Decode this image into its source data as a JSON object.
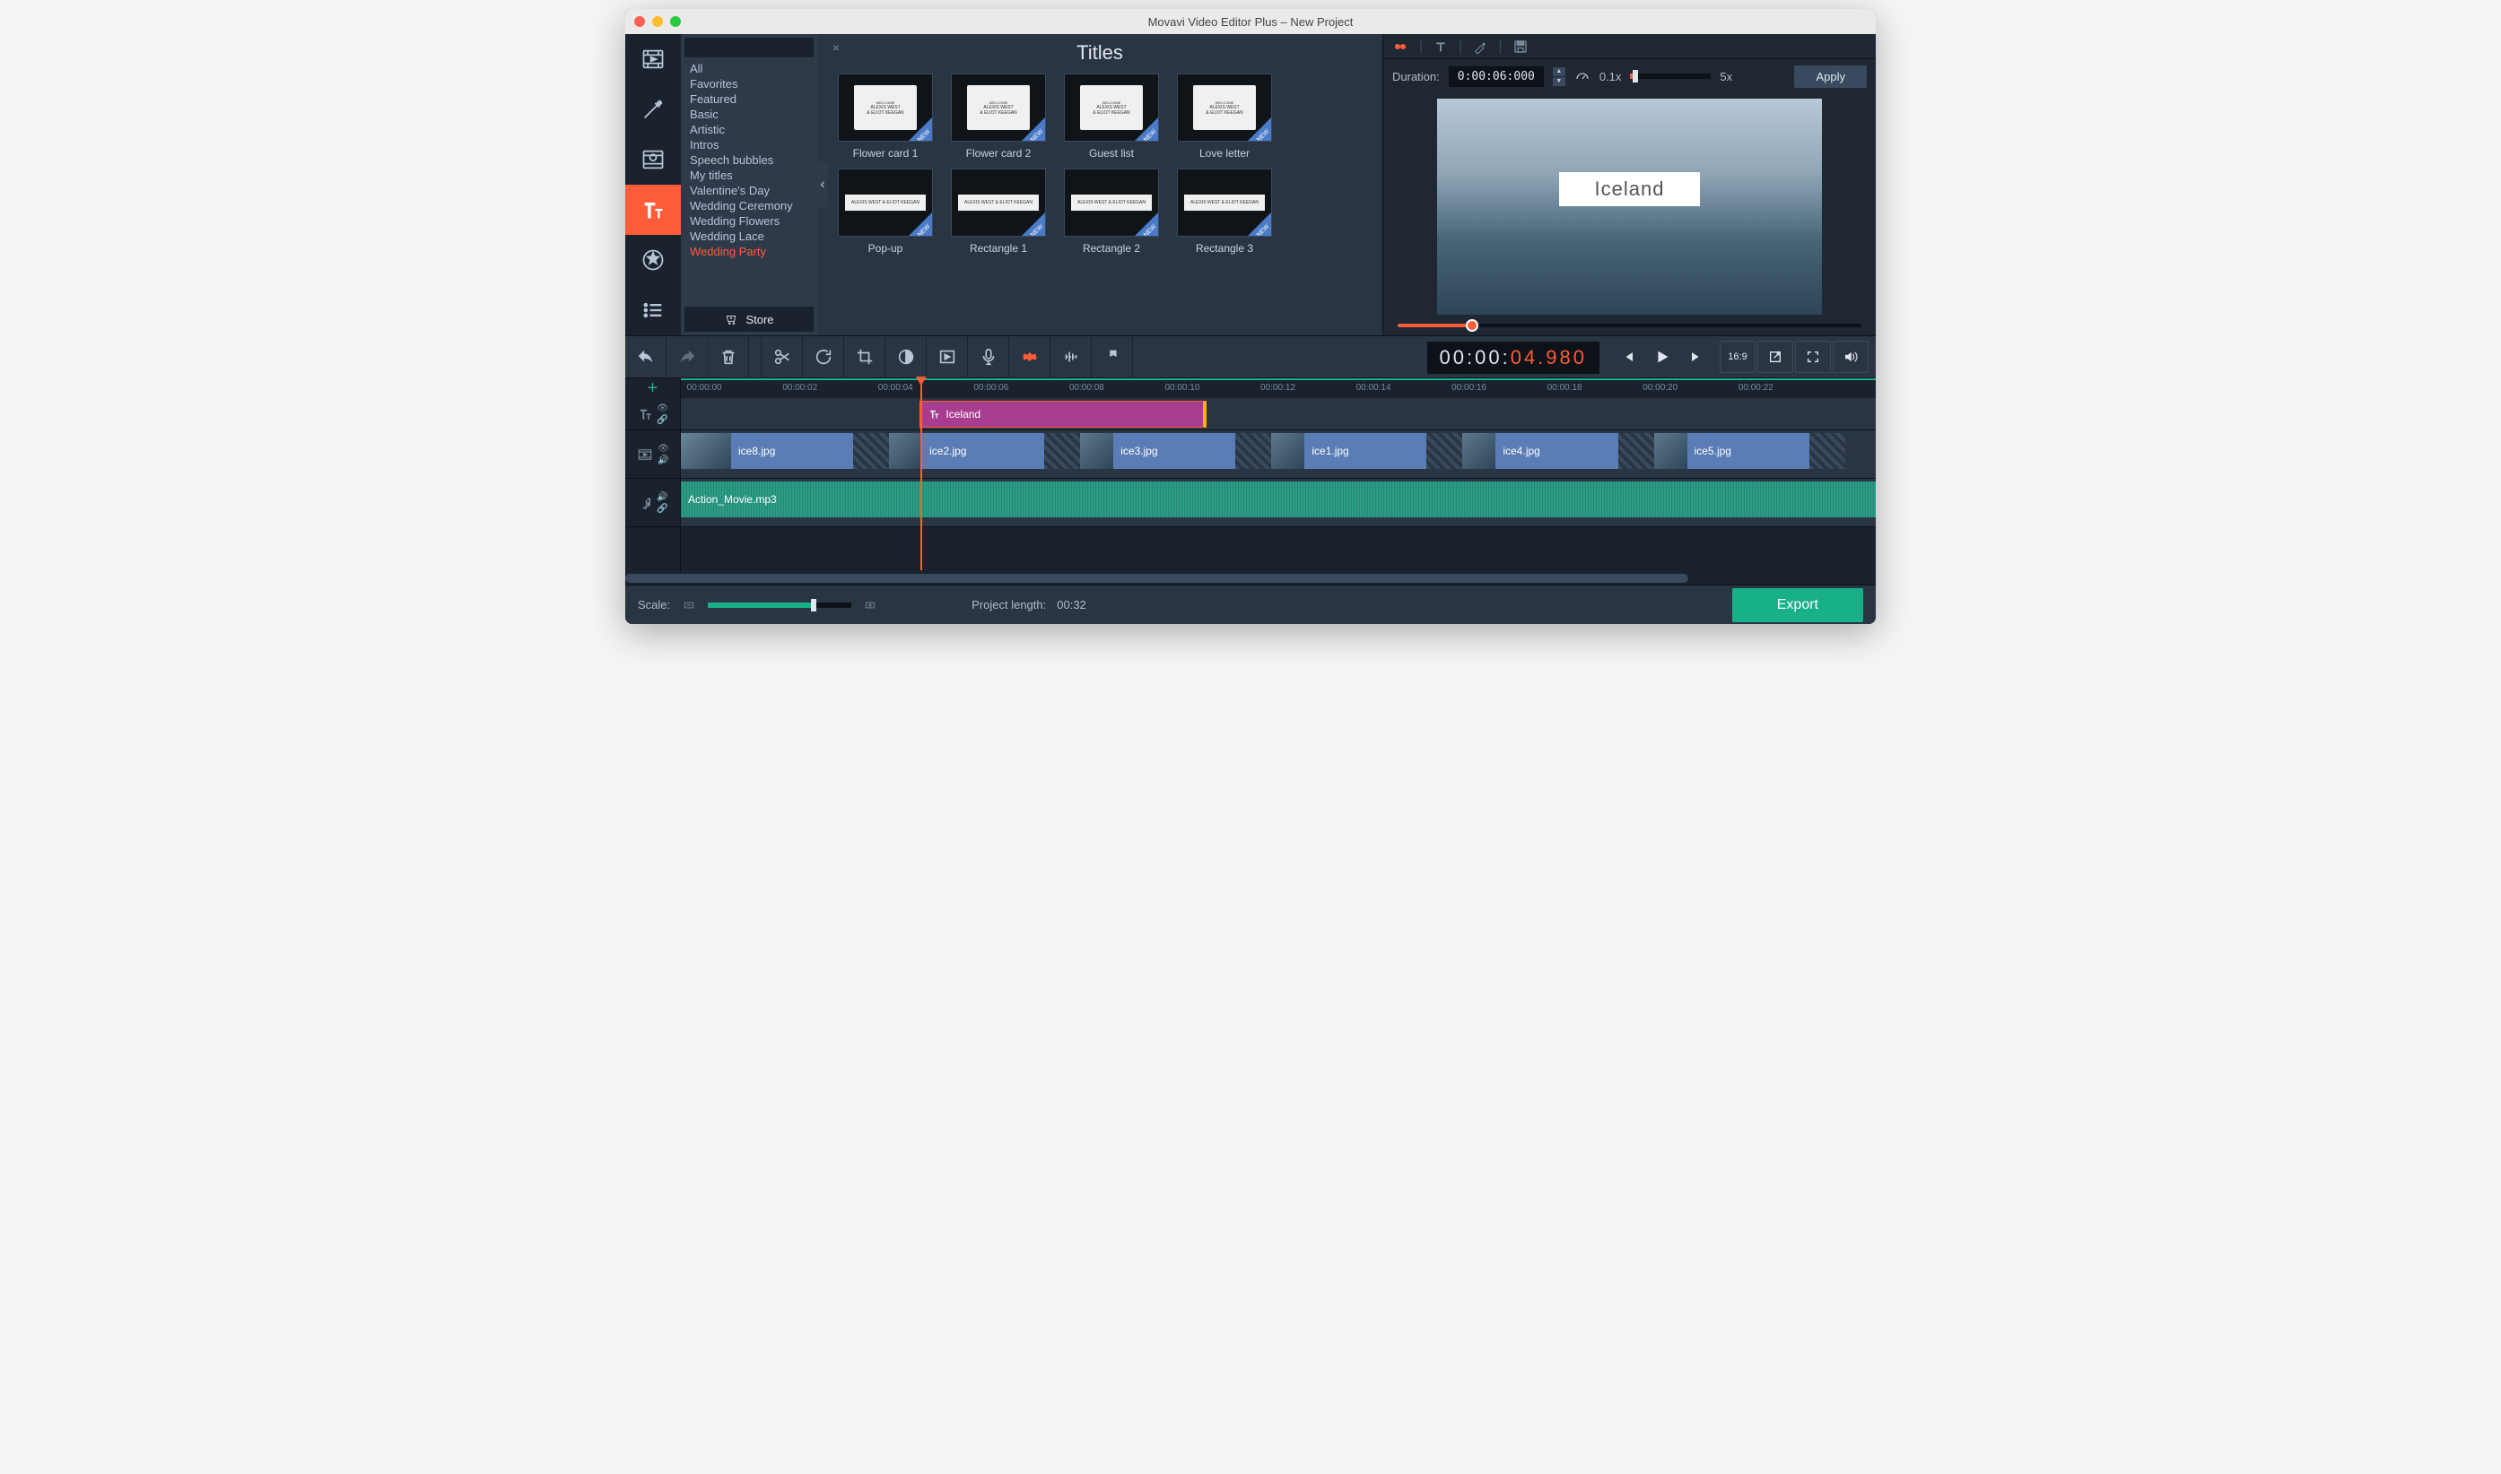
{
  "window": {
    "title": "Movavi Video Editor Plus – New Project"
  },
  "sidebar_categories": {
    "items": [
      "All",
      "Favorites",
      "Featured",
      "Basic",
      "Artistic",
      "Intros",
      "Speech bubbles",
      "My titles",
      "Valentine's Day",
      "Wedding Ceremony",
      "Wedding Flowers",
      "Wedding Lace",
      "Wedding Party"
    ],
    "selected": "Wedding Party",
    "store": "Store"
  },
  "titles_panel": {
    "heading": "Titles",
    "items": [
      {
        "label": "Flower card 1"
      },
      {
        "label": "Flower card 2"
      },
      {
        "label": "Guest list"
      },
      {
        "label": "Love letter"
      },
      {
        "label": "Pop-up"
      },
      {
        "label": "Rectangle 1"
      },
      {
        "label": "Rectangle 2"
      },
      {
        "label": "Rectangle 3"
      }
    ]
  },
  "preview": {
    "duration_label": "Duration:",
    "duration_value": "0:00:06:000",
    "speed_value": "0.1x",
    "speed_max": "5x",
    "apply": "Apply",
    "overlay_text": "Iceland"
  },
  "playback": {
    "timecode_whole": "00:00:",
    "timecode_frac": "04.980",
    "aspect": "16:9"
  },
  "ruler": {
    "ticks": [
      "00:00:00",
      "00:00:02",
      "00:00:04",
      "00:00:06",
      "00:00:08",
      "00:00:10",
      "00:00:12",
      "00:00:14",
      "00:00:16",
      "00:00:18",
      "00:00:20",
      "00:00:22"
    ],
    "playhead_percent": 20
  },
  "timeline": {
    "title_clip": {
      "label": "Iceland",
      "left_pct": 20,
      "width_pct": 24
    },
    "video_clips": [
      {
        "label": "ice8.jpg",
        "left_pct": 0,
        "width_pct": 16
      },
      {
        "label": "ice2.jpg",
        "left_pct": 16,
        "width_pct": 16
      },
      {
        "label": "ice3.jpg",
        "left_pct": 32,
        "width_pct": 16
      },
      {
        "label": "ice1.jpg",
        "left_pct": 48,
        "width_pct": 16
      },
      {
        "label": "ice4.jpg",
        "left_pct": 64,
        "width_pct": 16
      },
      {
        "label": "ice5.jpg",
        "left_pct": 80,
        "width_pct": 16
      }
    ],
    "audio_clip": {
      "label": "Action_Movie.mp3",
      "left_pct": 0,
      "width_pct": 100
    }
  },
  "footer": {
    "scale_label": "Scale:",
    "project_length_label": "Project length:",
    "project_length_value": "00:32",
    "export": "Export"
  }
}
